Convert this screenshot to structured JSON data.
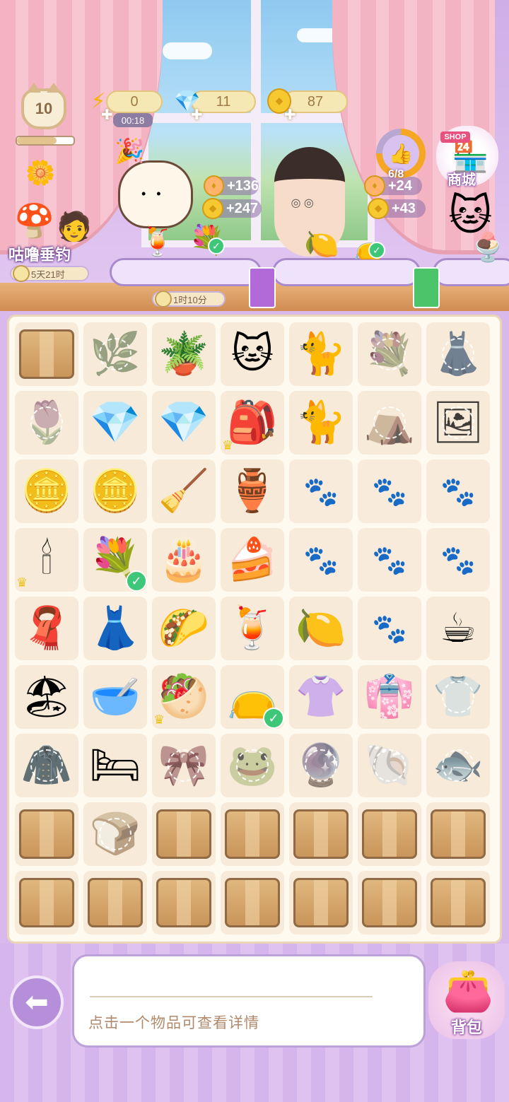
{
  "player": {
    "level": "10",
    "level_progress": 0.7
  },
  "resources": {
    "energy": {
      "value": "0",
      "timer": "00:18",
      "icon": "lightning-icon"
    },
    "gems": {
      "value": "11",
      "icon": "gem-icon"
    },
    "coins": {
      "value": "87",
      "icon": "coin-icon"
    }
  },
  "customers": [
    {
      "name": "cat",
      "reward_coins_a": "+136",
      "reward_coins_b": "+247"
    },
    {
      "name": "man",
      "reward_coins_a": "+24",
      "reward_coins_b": "+43"
    }
  ],
  "events": {
    "fishing": {
      "label": "咕噜垂钓",
      "timer": "5天21时"
    },
    "shelf_timer": "1时10分"
  },
  "tasks": {
    "progress": "6/8",
    "fraction": 0.75
  },
  "shop": {
    "label": "商城",
    "sign": "SHOP"
  },
  "board": {
    "rows": [
      [
        "box",
        "vine-locked",
        "watering-can-set",
        "lucky-cat",
        "calico-cat",
        "lilac-bouquet-locked",
        "clothes-rack-locked"
      ],
      [
        "tulip-locked",
        "pink-gems",
        "pink-gem",
        "cat-bag",
        "white-cat",
        "tent-locked",
        "frame-locked"
      ],
      [
        "coins-pile",
        "coin",
        "shovel",
        "glass-vase",
        "empty",
        "empty",
        "empty"
      ],
      [
        "candelabra",
        "flower-bouquet",
        "strawberry-cake",
        "cake-slice",
        "empty",
        "empty",
        "empty"
      ],
      [
        "towel",
        "black-dress",
        "cat-taco",
        "fruit-tea",
        "lemon-tea",
        "empty",
        "coffee-cup"
      ],
      [
        "beach-sign",
        "wooden-bowl",
        "fruit-crepe",
        "gold-pouch",
        "maid-outfit",
        "pink-robe",
        "shirt-locked"
      ],
      [
        "cloak-locked",
        "pet-bed",
        "ribbon-locked",
        "frog-locked",
        "ball-locked",
        "shell-locked",
        "fish-locked"
      ],
      [
        "box",
        "bread-locked",
        "box",
        "box",
        "box",
        "box",
        "box"
      ],
      [
        "box",
        "box",
        "box",
        "box",
        "box",
        "box",
        "box"
      ]
    ]
  },
  "info": {
    "hint": "点击一个物品可查看详情"
  },
  "bag": {
    "label": "背包"
  },
  "colors": {
    "accent": "#b58fd9",
    "board_bg": "#fffaf0",
    "check": "#3ec779"
  }
}
